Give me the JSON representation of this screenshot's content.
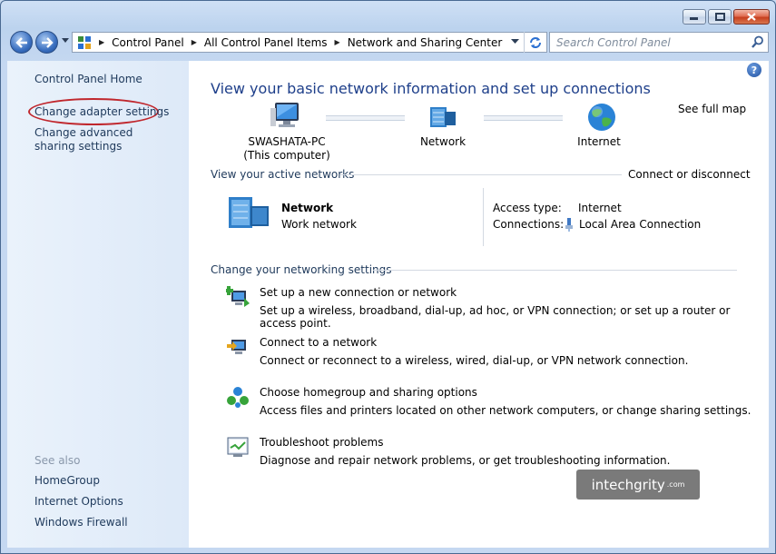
{
  "window": {
    "caption_buttons": [
      "minimize",
      "maximize",
      "close"
    ]
  },
  "toolbar": {
    "breadcrumbs": [
      "Control Panel",
      "All Control Panel Items",
      "Network and Sharing Center"
    ],
    "search_placeholder": "Search Control Panel"
  },
  "sidebar": {
    "home": "Control Panel Home",
    "links": [
      "Change adapter settings",
      "Change advanced sharing settings"
    ],
    "see_also_heading": "See also",
    "see_also": [
      "HomeGroup",
      "Internet Options",
      "Windows Firewall"
    ],
    "highlight_color": "#c0272d"
  },
  "main": {
    "title": "View your basic network information and set up connections",
    "see_full_map": "See full map",
    "map": {
      "computer_name": "SWASHATA-PC",
      "computer_sub": "(This computer)",
      "network": "Network",
      "internet": "Internet"
    },
    "active_networks": {
      "heading": "View your active networks",
      "connect_link": "Connect or disconnect",
      "network_name": "Network",
      "network_type": "Work network",
      "access_type_label": "Access type:",
      "access_type_value": "Internet",
      "connections_label": "Connections:",
      "connection_value": "Local Area Connection"
    },
    "change_settings": {
      "heading": "Change your networking settings",
      "tasks": [
        {
          "title": "Set up a new connection or network",
          "desc": "Set up a wireless, broadband, dial-up, ad hoc, or VPN connection; or set up a router or access point.",
          "icon": "new-connection-icon"
        },
        {
          "title": "Connect to a network",
          "desc": "Connect or reconnect to a wireless, wired, dial-up, or VPN network connection.",
          "icon": "connect-network-icon"
        },
        {
          "title": "Choose homegroup and sharing options",
          "desc": "Access files and printers located on other network computers, or change sharing settings.",
          "icon": "homegroup-icon"
        },
        {
          "title": "Troubleshoot problems",
          "desc": "Diagnose and repair network problems, or get troubleshooting information.",
          "icon": "troubleshoot-icon"
        }
      ]
    },
    "watermark": {
      "text": "intechgrity",
      "suffix": ".com"
    }
  },
  "colors": {
    "link": "#0b63c8",
    "title": "#1e3f8a",
    "nav_text": "#1e395b"
  }
}
